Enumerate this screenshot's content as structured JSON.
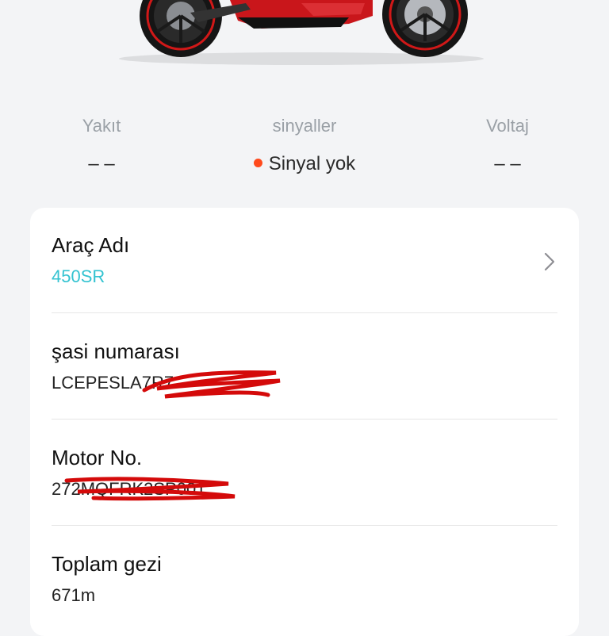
{
  "stats": {
    "fuel": {
      "label": "Yakıt",
      "value": "– –"
    },
    "signals": {
      "label": "sinyaller",
      "value": "Sinyal yok",
      "dot_color": "#ff4a1c"
    },
    "voltage": {
      "label": "Voltaj",
      "value": "– –"
    }
  },
  "card": {
    "vehicle_name": {
      "title": "Araç Adı",
      "value": "450SR",
      "value_color": "#34c3d1"
    },
    "chassis": {
      "title": "şasi numarası",
      "value": "LCEPESLA7R7"
    },
    "motor": {
      "title": "Motor No.",
      "value": "272MQFRK2SP001"
    },
    "total_trip": {
      "title": "Toplam gezi",
      "value": "671m"
    }
  },
  "icons": {
    "chevron": "chevron-right-icon",
    "motorcycle": "motorcycle-image"
  }
}
